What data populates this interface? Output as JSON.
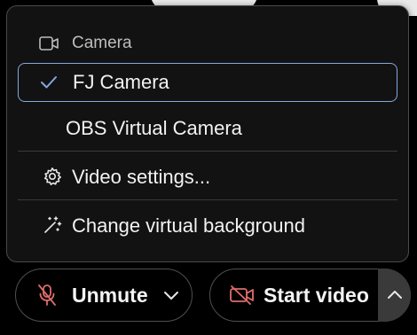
{
  "menu": {
    "header": {
      "label": "Camera",
      "icon": "camera-icon"
    },
    "cameras": [
      {
        "label": "FJ Camera",
        "selected": true
      },
      {
        "label": "OBS Virtual Camera",
        "selected": false
      }
    ],
    "video_settings_label": "Video settings...",
    "virtual_background_label": "Change virtual background"
  },
  "toolbar": {
    "unmute_label": "Unmute",
    "start_video_label": "Start video"
  },
  "colors": {
    "menu_bg": "#121212",
    "selected_border": "#86a7df",
    "muted_red": "#e06c6c"
  }
}
